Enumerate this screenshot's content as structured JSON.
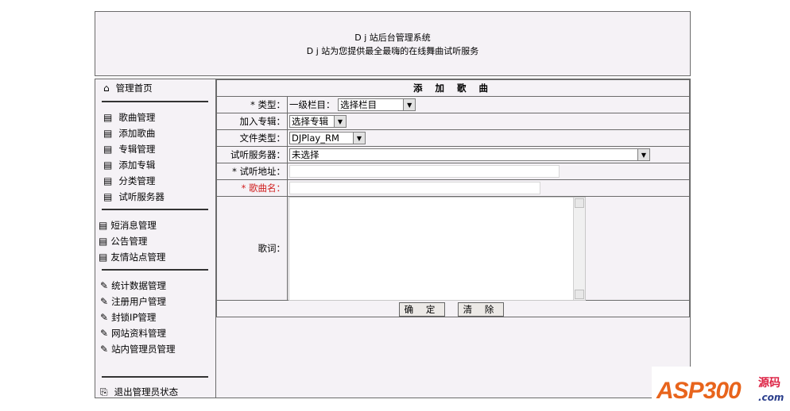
{
  "header": {
    "line1": "D j 站后台管理系统",
    "line2": "D j 站为您提供最全最嗨的在线舞曲试听服务"
  },
  "sidebar": {
    "home": "管理首页",
    "group1": [
      "歌曲管理",
      "添加歌曲",
      "专辑管理",
      "添加专辑",
      "分类管理",
      "试听服务器"
    ],
    "group2": [
      "短消息管理",
      "公告管理",
      "友情站点管理"
    ],
    "group3": [
      "统计数据管理",
      "注册用户管理",
      "封锁IP管理",
      "网站资料管理",
      "站内管理员管理"
    ],
    "logout": "退出管理员状态"
  },
  "form": {
    "title": "添 加 歌 曲",
    "type_label": "* 类型：",
    "type_prefix": "一级栏目：",
    "type_value": "选择栏目",
    "album_label": "加入专辑：",
    "album_value": "选择专辑",
    "filetype_label": "文件类型：",
    "filetype_value": "DJPlay_RM",
    "server_label": "试听服务器：",
    "server_value": "未选择",
    "url_label": "* 试听地址：",
    "url_value": "",
    "name_label": "* 歌曲名：",
    "name_value": "",
    "lyrics_label": "歌词：",
    "submit": "确 定",
    "clear": "清 除"
  },
  "watermark": {
    "brand": "ASP300",
    "cn": "源码",
    "domain": ".com"
  },
  "colors": {
    "panel_bg": "#f5f2f6",
    "border": "#6b6b6b",
    "required_red": "#d02020",
    "watermark_orange": "#e8641c"
  }
}
